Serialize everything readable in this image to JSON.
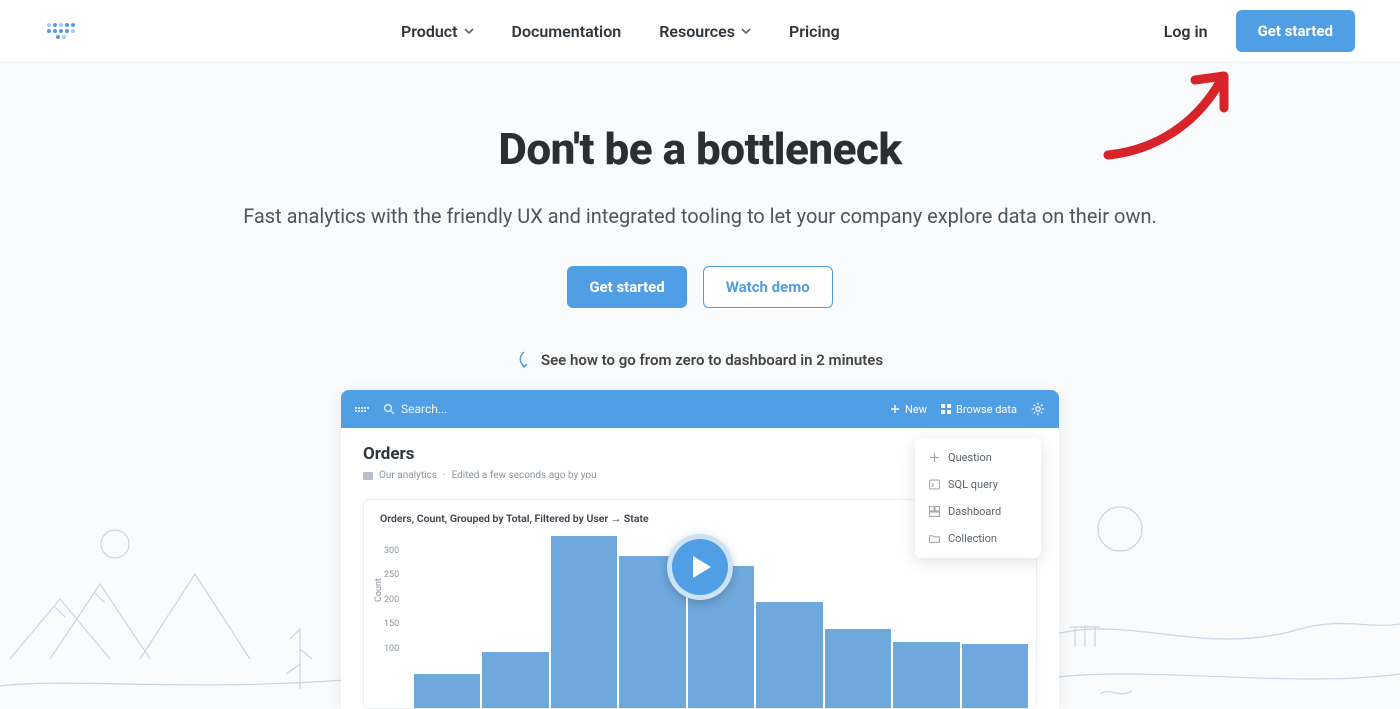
{
  "nav": {
    "items": [
      {
        "label": "Product",
        "dropdown": true
      },
      {
        "label": "Documentation",
        "dropdown": false
      },
      {
        "label": "Resources",
        "dropdown": true
      },
      {
        "label": "Pricing",
        "dropdown": false
      }
    ],
    "login": "Log in",
    "cta": "Get started"
  },
  "hero": {
    "headline": "Don't be a bottleneck",
    "subtext": "Fast analytics with the friendly UX and integrated tooling to let your company explore data on their own.",
    "primary": "Get started",
    "secondary": "Watch demo",
    "teaser": "See how to go from zero to dashboard in 2 minutes"
  },
  "app": {
    "search_placeholder": "Search...",
    "new": "New",
    "browse": "Browse data",
    "title": "Orders",
    "crumb": "Our analytics",
    "edited": "Edited a few seconds ago by you",
    "chart_title": "Orders, Count, Grouped by Total, Filtered by User → State",
    "menu": [
      "Question",
      "SQL query",
      "Dashboard",
      "Collection"
    ]
  },
  "chart_data": {
    "type": "bar",
    "title": "Orders, Count, Grouped by Total, Filtered by User → State",
    "ylabel": "Count",
    "ylim": [
      0,
      350
    ],
    "yticks": [
      100,
      150,
      200,
      250,
      300
    ],
    "values": [
      70,
      115,
      350,
      310,
      290,
      215,
      160,
      135,
      130
    ]
  },
  "colors": {
    "brand": "#509ee3"
  }
}
